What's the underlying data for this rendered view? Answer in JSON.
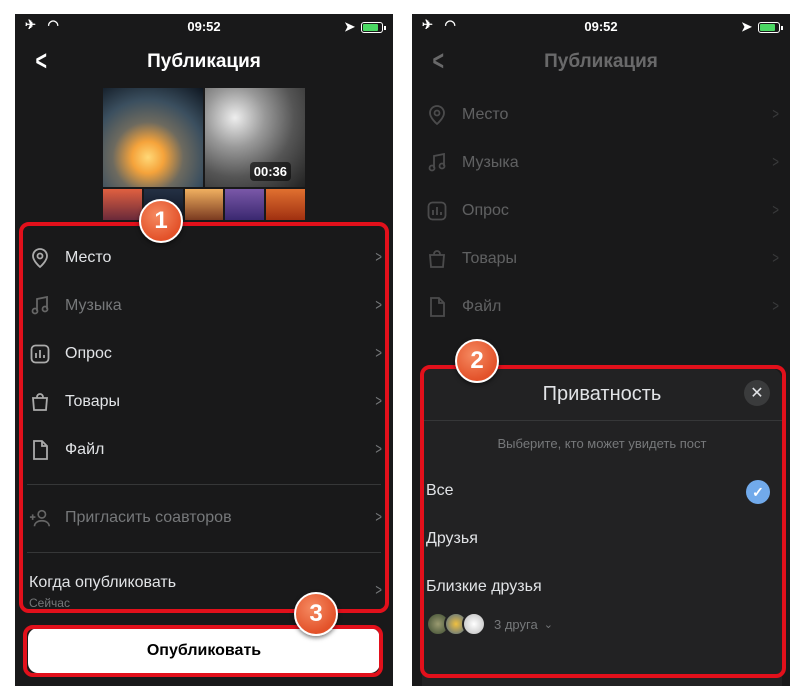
{
  "status": {
    "time": "09:52"
  },
  "left": {
    "title": "Публикация",
    "video_duration": "00:36",
    "items": [
      {
        "label": "Место",
        "icon": "location-pin-icon"
      },
      {
        "label": "Музыка",
        "icon": "music-note-icon"
      },
      {
        "label": "Опрос",
        "icon": "poll-icon"
      },
      {
        "label": "Товары",
        "icon": "shopping-bag-icon"
      },
      {
        "label": "Файл",
        "icon": "file-icon"
      }
    ],
    "invite_label": "Пригласить соавторов",
    "when_label": "Когда опубликовать",
    "when_value": "Сейчас",
    "publish_label": "Опубликовать"
  },
  "right": {
    "title": "Публикация",
    "items": [
      {
        "label": "Место",
        "icon": "location-pin-icon"
      },
      {
        "label": "Музыка",
        "icon": "music-note-icon"
      },
      {
        "label": "Опрос",
        "icon": "poll-icon"
      },
      {
        "label": "Товары",
        "icon": "shopping-bag-icon"
      },
      {
        "label": "Файл",
        "icon": "file-icon"
      }
    ],
    "sheet": {
      "title": "Приватность",
      "subtitle": "Выберите, кто может увидеть пост",
      "options": [
        {
          "label": "Все",
          "selected": true
        },
        {
          "label": "Друзья",
          "selected": false
        },
        {
          "label": "Близкие друзья",
          "selected": false
        }
      ],
      "friends_count": "3 друга"
    }
  },
  "badges": [
    "1",
    "2",
    "3"
  ],
  "colors": {
    "accent": "#71aaeb",
    "highlight": "#e2101b",
    "badge": "#e3522a",
    "background": "#19191a"
  }
}
